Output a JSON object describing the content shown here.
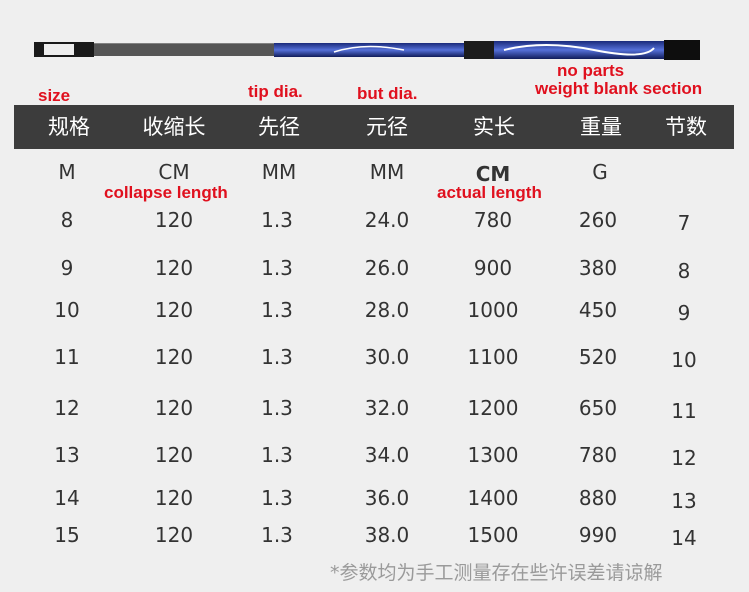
{
  "annotations": {
    "size": "size",
    "tip_dia": "tip dia.",
    "but_dia": "but dia.",
    "no_parts": "no parts",
    "weight_blank": "weight blank section",
    "collapse_length": "collapse length",
    "actual_length": "actual length"
  },
  "table": {
    "headers": [
      "规格",
      "收缩长",
      "先径",
      "元径",
      "实长",
      "重量",
      "节数"
    ],
    "units": [
      "M",
      "CM",
      "MM",
      "MM",
      "CM",
      "G",
      ""
    ],
    "rows": [
      [
        "8",
        "120",
        "1.3",
        "24.0",
        "780",
        "260",
        "7"
      ],
      [
        "9",
        "120",
        "1.3",
        "26.0",
        "900",
        "380",
        "8"
      ],
      [
        "10",
        "120",
        "1.3",
        "28.0",
        "1000",
        "450",
        "9"
      ],
      [
        "11",
        "120",
        "1.3",
        "30.0",
        "1100",
        "520",
        "10"
      ],
      [
        "12",
        "120",
        "1.3",
        "32.0",
        "1200",
        "650",
        "11"
      ],
      [
        "13",
        "120",
        "1.3",
        "34.0",
        "1300",
        "780",
        "12"
      ],
      [
        "14",
        "120",
        "1.3",
        "36.0",
        "1400",
        "880",
        "13"
      ],
      [
        "15",
        "120",
        "1.3",
        "38.0",
        "1500",
        "990",
        "14"
      ]
    ]
  },
  "footnote": "*参数均为手工测量存在些许误差请谅解",
  "colors": {
    "header_bg": "#3c3c3c",
    "annotation_red": "#e0101e",
    "rod_blue": "#2a3d9e"
  }
}
